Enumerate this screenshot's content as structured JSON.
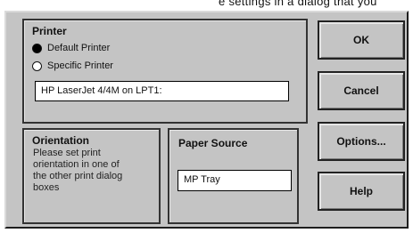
{
  "window": {
    "partial_title": "e settings in a dialog that you"
  },
  "printer": {
    "title": "Printer",
    "options": [
      {
        "label": "Default Printer",
        "selected": true
      },
      {
        "label": "Specific Printer",
        "selected": false
      }
    ],
    "printer_value": "HP LaserJet 4/4M on LPT1:"
  },
  "orientation": {
    "title": "Orientation",
    "description": "Please set print orientation in one of the other print dialog boxes"
  },
  "paper_source": {
    "title": "Paper Source",
    "value": "MP Tray"
  },
  "buttons": {
    "ok": "OK",
    "cancel": "Cancel",
    "options": "Options...",
    "help": "Help"
  },
  "colors": {
    "dialog_face": "#c4c4c4",
    "border_dark": "#1e1e1e",
    "field_bg": "#ffffff"
  }
}
